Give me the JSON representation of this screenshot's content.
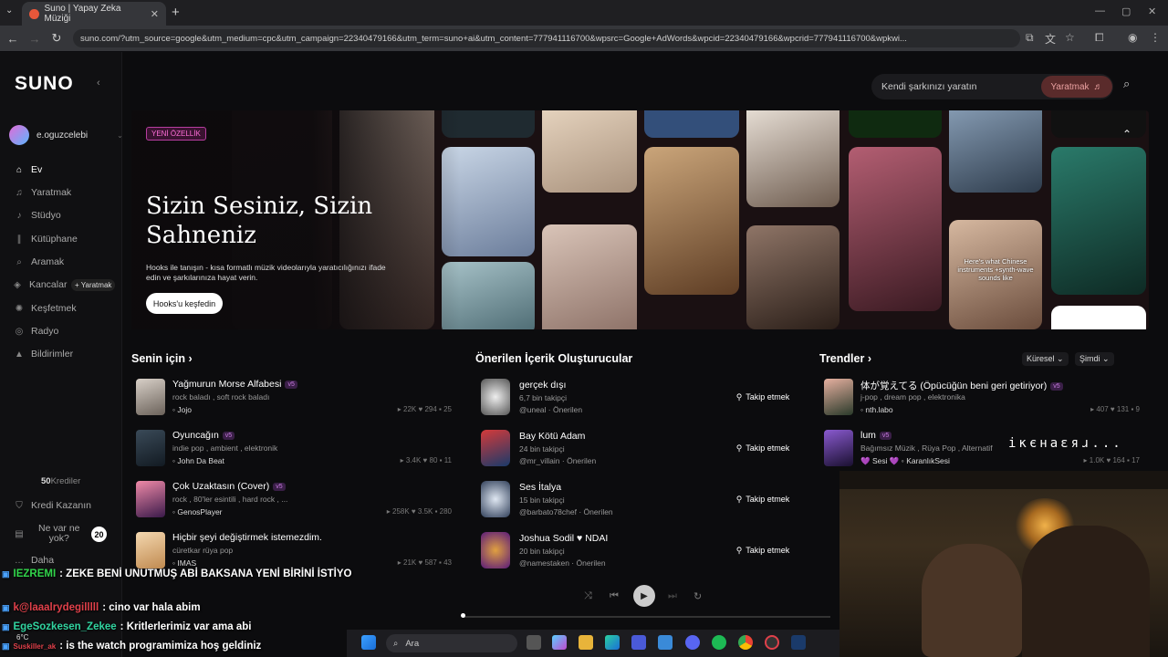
{
  "browser": {
    "tab_title": "Suno | Yapay Zeka Müziği",
    "url": "suno.com/?utm_source=google&utm_medium=cpc&utm_campaign=22340479166&utm_term=suno+ai&utm_content=777941116700&wpsrc=Google+AdWords&wpcid=22340479166&wpcrid=777941116700&wpkwi...",
    "new_tab": "+"
  },
  "sidebar": {
    "logo": "SUNO",
    "username": "e.oguzcelebi",
    "items": [
      {
        "label": "Ev",
        "icon": "home-icon",
        "active": true
      },
      {
        "label": "Yaratmak",
        "icon": "music-note-icon"
      },
      {
        "label": "Stüdyo",
        "icon": "studio-icon"
      },
      {
        "label": "Kütüphane",
        "icon": "library-icon"
      },
      {
        "label": "Aramak",
        "icon": "search-icon"
      },
      {
        "label": "Kancalar",
        "icon": "hook-icon"
      },
      {
        "label": "Keşfetmek",
        "icon": "compass-icon"
      },
      {
        "label": "Radyo",
        "icon": "radio-icon"
      },
      {
        "label": "Bildirimler",
        "icon": "bell-icon"
      }
    ],
    "create_badge": "+ Yaratmak",
    "credits_value": "50",
    "credits_label": "Krediler",
    "earn_credits": "Kredi Kazanın",
    "whats_new_line1": "Ne var ne",
    "whats_new_line2": "yok?",
    "whats_new_count": "20",
    "more": "Daha"
  },
  "header": {
    "create_placeholder": "Kendi şarkınızı yaratın",
    "create_button": "Yaratmak"
  },
  "hero": {
    "tag": "YENİ ÖZELLİK",
    "title": "Sizin Sesiniz, Sizin Sahneniz",
    "description": "Hooks ile tanışın - kısa formatlı müzik videolarıyla yaratıcılığınızı ifade edin ve şarkılarınıza hayat verin.",
    "button": "Hooks'u keşfedin",
    "caption": "Here's what Chinese instruments +synth-wave sounds like"
  },
  "for_you": {
    "title": "Senin için",
    "songs": [
      {
        "title": "Yağmurun Morse Alfabesi",
        "badge": "v5",
        "tags": "rock baladı , soft rock baladı",
        "artist": "Jojo",
        "plays": "22K",
        "likes": "294",
        "comments": "25"
      },
      {
        "title": "Oyuncağın",
        "badge": "v5",
        "tags": "indie pop , ambient , elektronik",
        "artist": "John Da Beat",
        "plays": "3.4K",
        "likes": "80",
        "comments": "11"
      },
      {
        "title": "Çok Uzaktasın (Cover)",
        "badge": "v5",
        "tags": "rock , 80'ler esintili , hard rock , ...",
        "artist": "GenosPlayer",
        "plays": "258K",
        "likes": "3.5K",
        "comments": "280"
      },
      {
        "title": "Hiçbir şeyi değiştirmek istemezdim.",
        "badge": "",
        "tags": "cüretkar rüya pop",
        "artist": "IMAS",
        "plays": "21K",
        "likes": "587",
        "comments": "43"
      }
    ]
  },
  "creators": {
    "title": "Önerilen İçerik Oluşturucular",
    "follow_label": "Takip etmek",
    "items": [
      {
        "name": "gerçek dışı",
        "followers": "6,7 bin takipçi",
        "handle": "@uneal · Önerilen"
      },
      {
        "name": "Bay Kötü Adam",
        "followers": "24 bin takipçi",
        "handle": "@mr_villain · Önerilen"
      },
      {
        "name": "Ses İtalya",
        "followers": "15 bin takipçi",
        "handle": "@barbato78chef · Önerilen"
      },
      {
        "name": "Joshua Sodil ♥ NDAI",
        "followers": "20 bin takipçi",
        "handle": "@namestaken · Önerilen"
      }
    ]
  },
  "trends": {
    "title": "Trendler",
    "filter_scope": "Küresel",
    "filter_time": "Şimdi",
    "songs": [
      {
        "title": "体が覚えてる (Öpücüğün beni geri getiriyor)",
        "badge": "v5",
        "tags": "j-pop , dream pop , elektronika",
        "artist": "nth.labo",
        "plays": "407",
        "likes": "131",
        "comments": "9"
      },
      {
        "title": "lum",
        "badge": "v5",
        "tags": "Bağımsız Müzik , Rüya Pop , Alternatif",
        "artist": "Sesi",
        "artist2": "KaranlıkSesi",
        "plays": "1.0K",
        "likes": "164",
        "comments": "17"
      }
    ]
  },
  "stream": {
    "overlay_text": "ікєнаɛяɹ...",
    "chat": [
      {
        "user": "IEZREMI",
        "message": ": ZEKE BENİ UNUTMUŞ ABİ BAKSANA YENİ BİRİNİ İSTİYO",
        "color": "#31d44a"
      },
      {
        "user": "k@laaalrydegilllll",
        "message": ": cino var hala abim",
        "color": "#e0404a"
      },
      {
        "user": "EgeSozkesen_Zekee",
        "message": ": Kritlerlerimiz var ama abi",
        "color": "#31d4a0"
      },
      {
        "user": "Suskiller_ak",
        "message": ": is the watch programimiza hoş geldiniz",
        "color": "#e0404a"
      }
    ]
  },
  "taskbar": {
    "search_placeholder": "Ara",
    "weather": "6°C"
  }
}
